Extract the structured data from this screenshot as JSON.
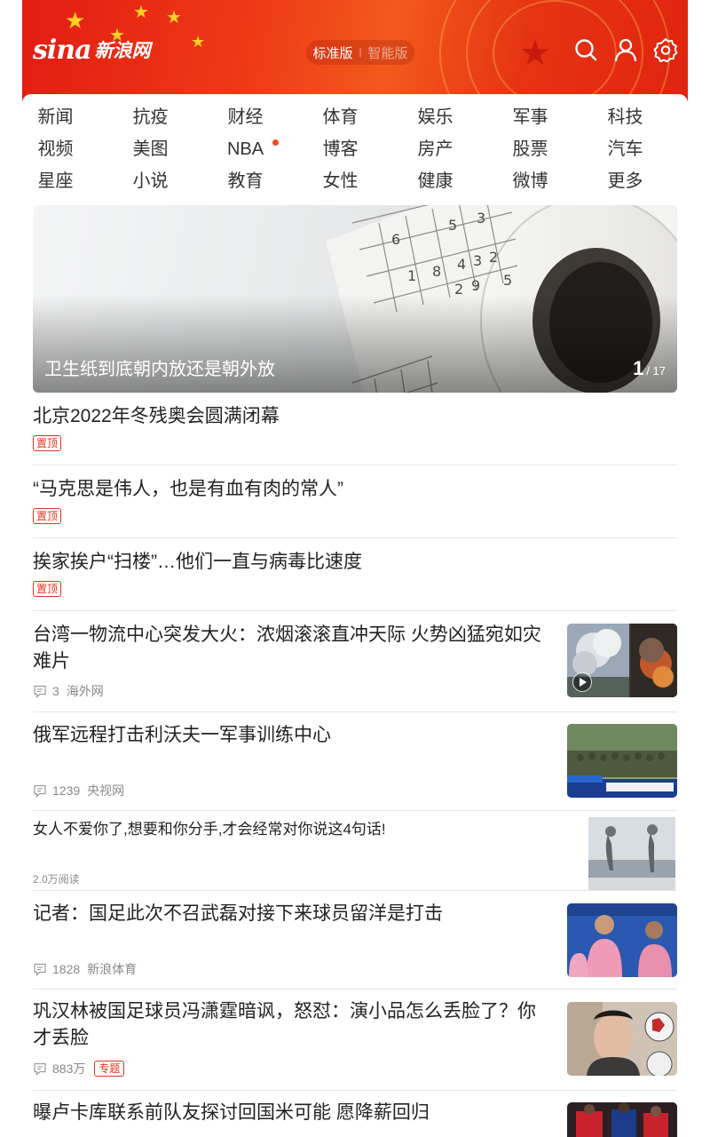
{
  "header": {
    "logo_text": "sina",
    "logo_cn": "新浪网",
    "version_standard": "标准版",
    "version_separator": "|",
    "version_smart": "智能版",
    "icons": [
      "search-icon",
      "user-icon",
      "settings-icon"
    ],
    "brand_color": "#e21d12"
  },
  "nav": {
    "items": [
      {
        "label": "新闻"
      },
      {
        "label": "抗疫"
      },
      {
        "label": "财经"
      },
      {
        "label": "体育"
      },
      {
        "label": "娱乐"
      },
      {
        "label": "军事"
      },
      {
        "label": "科技"
      },
      {
        "label": "视频"
      },
      {
        "label": "美图"
      },
      {
        "label": "NBA"
      },
      {
        "label": "博客"
      },
      {
        "label": "房产"
      },
      {
        "label": "股票"
      },
      {
        "label": "汽车"
      },
      {
        "label": "星座"
      },
      {
        "label": "小说"
      },
      {
        "label": "教育"
      },
      {
        "label": "女性"
      },
      {
        "label": "健康"
      },
      {
        "label": "微博"
      },
      {
        "label": "更多"
      }
    ]
  },
  "carousel": {
    "caption": "卫生纸到底朝内放还是朝外放",
    "current": "1",
    "total": "/ 17"
  },
  "news": {
    "pinned": [
      {
        "title": "北京2022年冬残奥会圆满闭幕",
        "badge": "置顶"
      },
      {
        "title": "“马克思是伟人，也是有血有肉的常人”",
        "badge": "置顶"
      },
      {
        "title": "挨家挨户“扫楼”…他们一直与病毒比速度",
        "badge": "置顶"
      }
    ],
    "articles": [
      {
        "title": "台湾一物流中心突发大火：浓烟滚滚直冲天际 火势凶猛宛如灾难片",
        "comments": "3",
        "source": "海外网",
        "video": true
      },
      {
        "title": "俄军远程打击利沃夫一军事训练中心",
        "comments": "1239",
        "source": "央视网"
      },
      {
        "title": "女人不爱你了,想要和你分手,才会经常对你说这4句话!",
        "reads": "2.0万阅读"
      },
      {
        "title": "记者：国足此次不召武磊对接下来球员留洋是打击",
        "comments": "1828",
        "source": "新浪体育"
      },
      {
        "title": "巩汉林被国足球员冯潇霆暗讽，怒怼：演小品怎么丢脸了？你才丢脸",
        "comments": "883万",
        "badge": "专题"
      },
      {
        "title": "曝卢卡库联系前队友探讨回国米可能 愿降薪回归"
      }
    ]
  }
}
